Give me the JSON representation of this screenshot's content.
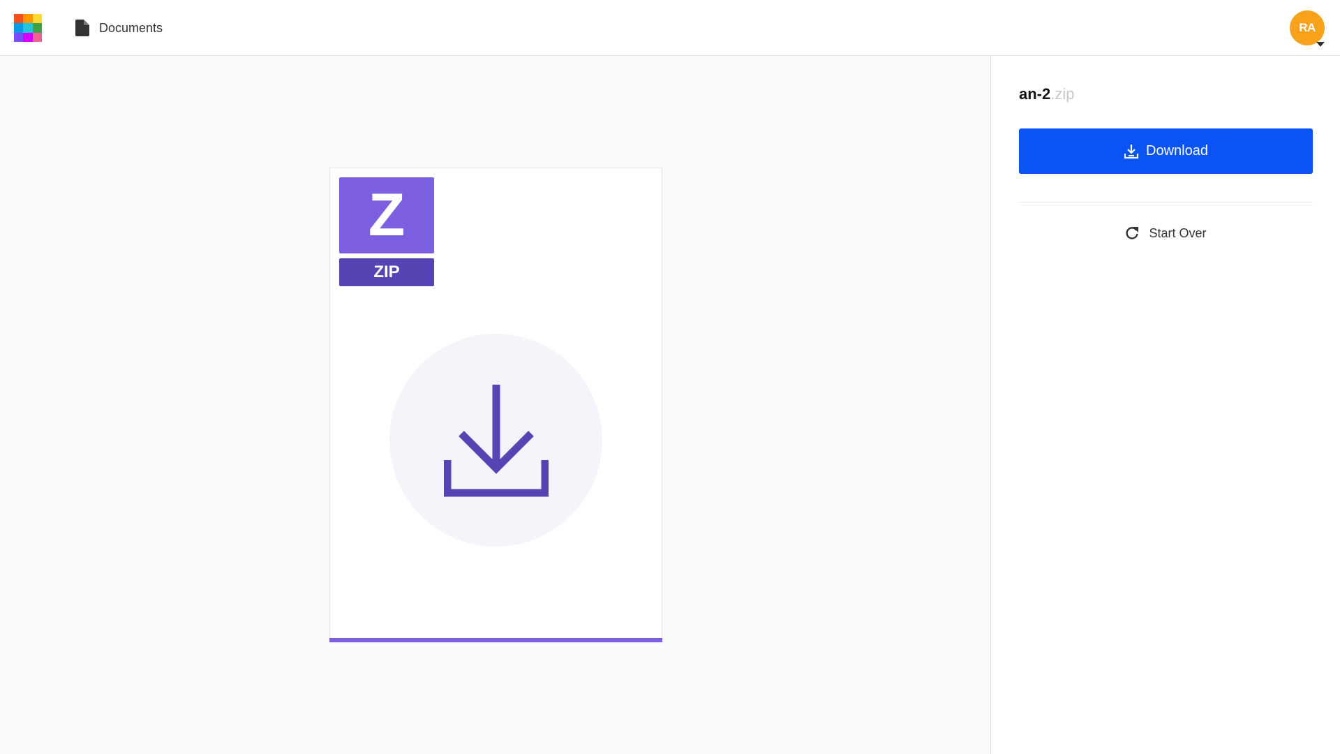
{
  "header": {
    "nav_documents_label": "Documents",
    "avatar_initials": "RA",
    "logo_colors": [
      "#f4511e",
      "#ff9800",
      "#fdd835",
      "#039be5",
      "#26c6da",
      "#43a047",
      "#7c4dff",
      "#d500f9",
      "#f06292"
    ],
    "avatar_color": "#f9a11b"
  },
  "preview": {
    "badge_letter": "Z",
    "badge_type": "ZIP",
    "badge_color": "#7b5fe0",
    "badge_dark_color": "#5843b4",
    "icon": "download-tray-icon",
    "progress": 1.0
  },
  "sidebar": {
    "file_name": "an-2",
    "file_ext": ".zip",
    "download_label": "Download",
    "download_icon": "download-icon",
    "start_over_label": "Start Over",
    "start_over_icon": "refresh-icon",
    "primary_color": "#0a53f5"
  }
}
